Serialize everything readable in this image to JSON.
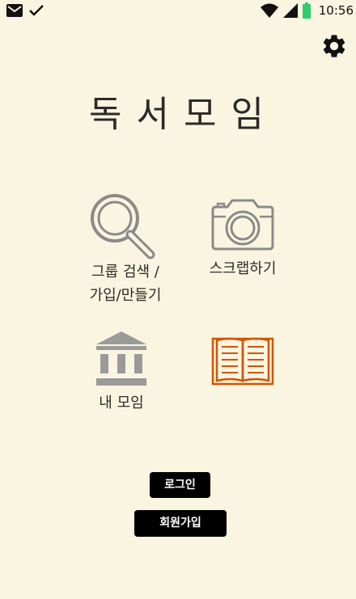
{
  "status_bar": {
    "time": "10:56",
    "icons": [
      "mail-icon",
      "check-icon",
      "wifi-icon",
      "signal-icon",
      "battery-icon"
    ],
    "battery_color": "#2ecc71"
  },
  "header": {
    "settings_icon": "gear-icon"
  },
  "app": {
    "title": "독서모임"
  },
  "menu": {
    "group": {
      "line1": "그룹 검색 /",
      "line2": "가입/만들기",
      "icon": "magnifier-icon"
    },
    "scrap": {
      "label": "스크랩하기",
      "icon": "camera-icon"
    },
    "my_group": {
      "label": "내 모임",
      "icon": "library-icon"
    },
    "book": {
      "icon": "open-book-icon",
      "color": "#d35400"
    }
  },
  "buttons": {
    "login": "로그인",
    "signup": "회원가입"
  },
  "colors": {
    "background": "#faf5e0",
    "icon_gray": "#8a8a8a",
    "button_bg": "#000000"
  }
}
